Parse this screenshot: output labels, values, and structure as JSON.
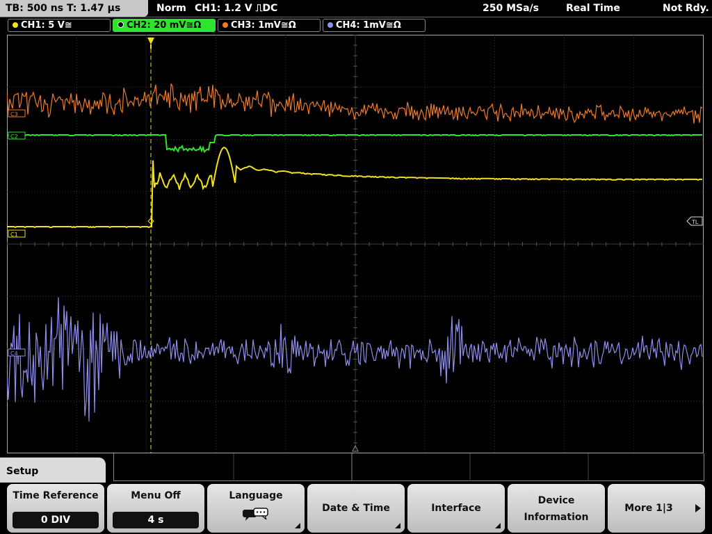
{
  "status": {
    "timebase": "TB: 500 ns   T: 1.47 µs",
    "trigger_mode": "Norm",
    "trigger_info": "CH1: 1.2 V ⎍DC",
    "sample_rate": "250 MSa/s",
    "acq_mode": "Real Time",
    "ready": "Not Rdy."
  },
  "channels": [
    {
      "label": "CH1: 5 V≅",
      "color": "#f2e21a",
      "marker": "C1"
    },
    {
      "label": "CH2: 20 mV≅Ω",
      "color": "#2ee52e",
      "marker": "C2"
    },
    {
      "label": "CH3: 1mV≅Ω",
      "color": "#f07a28",
      "marker": "C3"
    },
    {
      "label": "CH4: 1mV≅Ω",
      "color": "#8f8ff0",
      "marker": "C4"
    }
  ],
  "markers": {
    "trigger_level": "TL",
    "trigger": "T"
  },
  "menu": {
    "title": "Setup",
    "time_reference": {
      "label": "Time Reference",
      "value": "0 DIV"
    },
    "menu_off": {
      "label": "Menu Off",
      "value": "4 s"
    },
    "language": {
      "label": "Language",
      "icon": "speech-bubble-icon"
    },
    "date_time": {
      "label": "Date & Time"
    },
    "interface": {
      "label": "Interface"
    },
    "device_info": {
      "label1": "Device",
      "label2": "Information"
    },
    "more": {
      "label": "More 1|3"
    }
  }
}
